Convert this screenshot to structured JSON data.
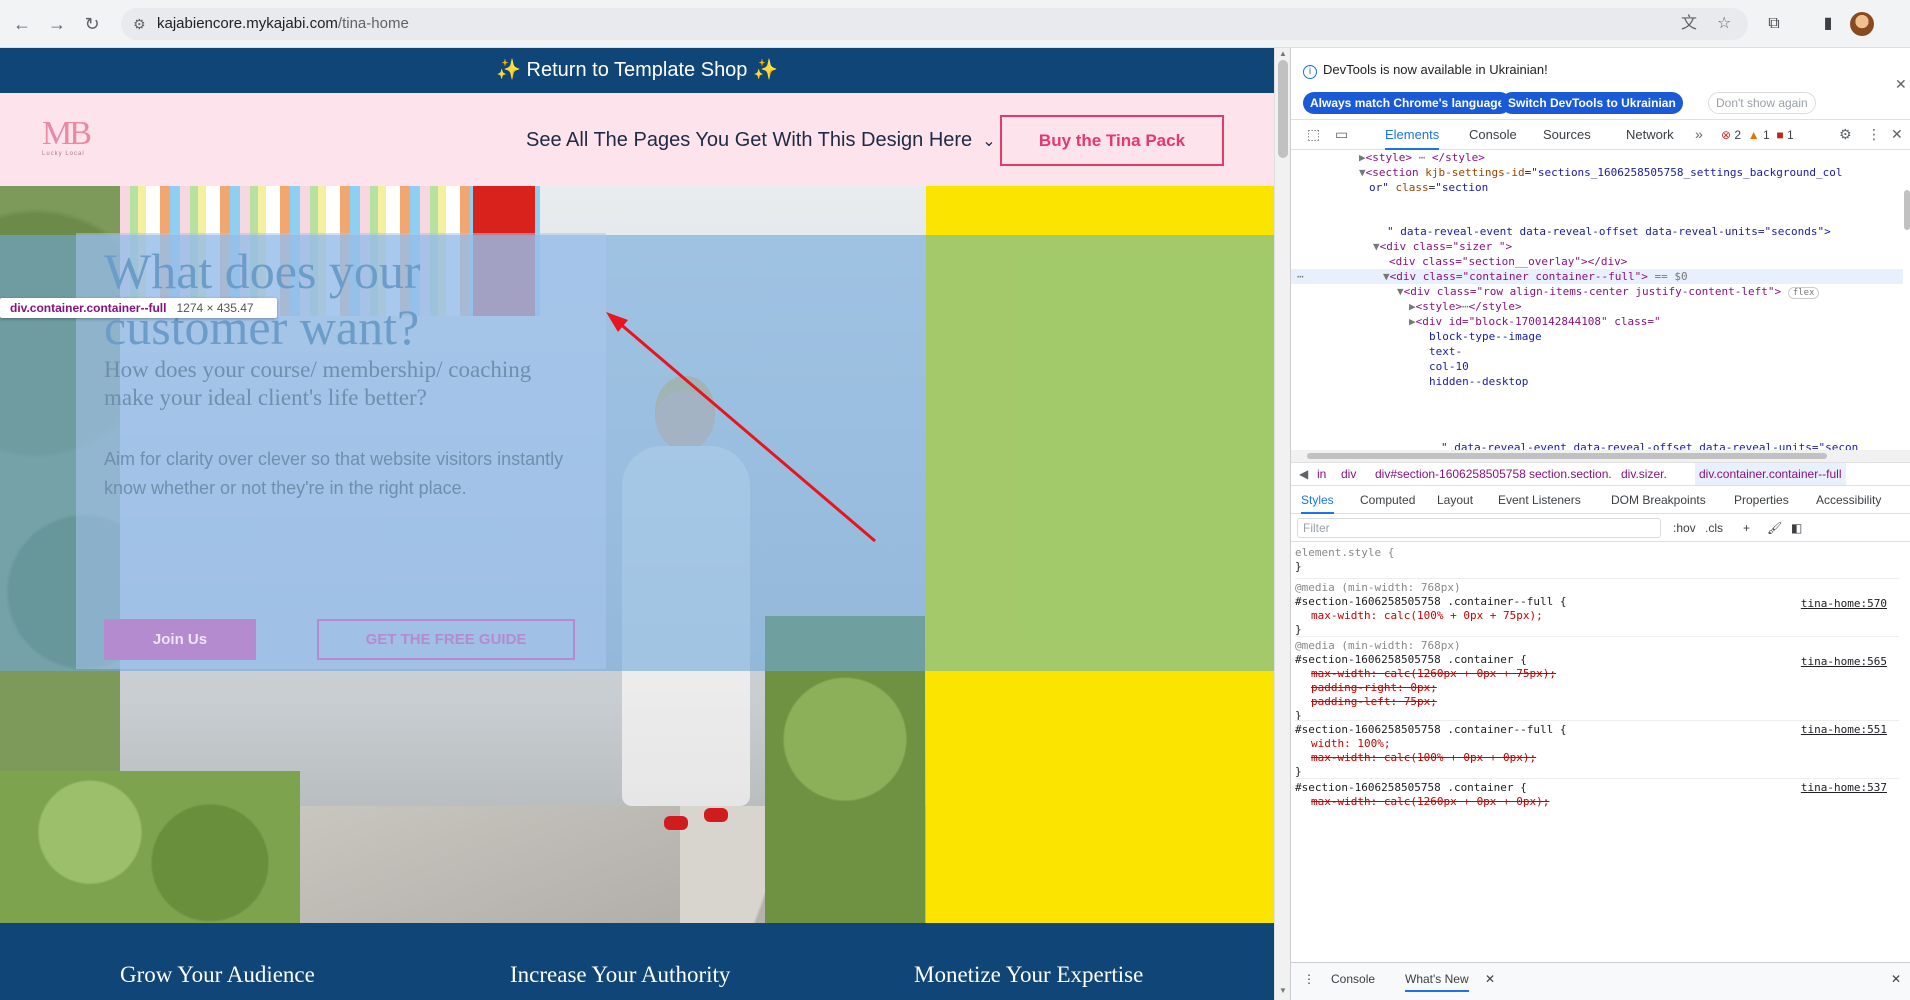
{
  "browser": {
    "url_host": "kajabiencore.mykajabi.com",
    "url_path": "/tina-home"
  },
  "page": {
    "topbar_text": "✨ Return to Template Shop ✨",
    "logo_text": "MB",
    "logo_sub": "Lucky Local",
    "nav_link": "See All The Pages You Get With This Design Here",
    "buy_button": "Buy the Tina Pack",
    "hero": {
      "title": "What does your customer want?",
      "subtitle": "How does your course/ membership/ coaching make your ideal client's life better?",
      "body": "Aim for clarity over clever so that website visitors instantly know whether or not they're in the right place.",
      "join_button": "Join Us",
      "guide_button": "GET THE FREE GUIDE"
    },
    "tooltip": {
      "selector": "div.container.container--full",
      "dims": "1274 × 435.47"
    },
    "features": [
      "Grow Your Audience",
      "Increase Your Authority",
      "Monetize Your Expertise"
    ]
  },
  "devtools": {
    "info_message": "DevTools is now available in Ukrainian!",
    "btn_match": "Always match Chrome's language",
    "btn_switch": "Switch DevTools to Ukrainian",
    "btn_dont": "Don't show again",
    "tabs": [
      "Elements",
      "Console",
      "Sources",
      "Network"
    ],
    "counts": {
      "errors": "2",
      "warnings": "1",
      "issues": "1"
    },
    "dom": {
      "l1": "<style>",
      "l1b": "</style>",
      "l2a": "<section",
      "l2attr": "kjb-settings-id",
      "l2val": "\"sections_1606258505758_settings_background_col",
      "l3": "or\"",
      "l3attr": "class",
      "l3val": "\"section",
      "l4": "\" data-reveal-event data-reveal-offset data-reveal-units=\"seconds\">",
      "l5": "<div class=\"sizer \">",
      "l6": "<div class=\"section__overlay\"></div>",
      "l7": "<div class=\"container container--full\">",
      "l7b": "== $0",
      "l8": "<div class=\"row align-items-center justify-content-left\">",
      "l8b": "flex",
      "l9": "<style>",
      "l9b": "</style>",
      "l10": "<div id=\"block-1700142844108\" class=\"",
      "l11": "block-type--image",
      "l12": "text-",
      "l13": "col-10",
      "l14": "hidden--desktop",
      "l15": "\" data-reveal-event data-reveal-offset data-reveal-units=\"secon"
    },
    "crumbs": [
      "in",
      "div",
      "div#section-1606258505758",
      "section.section.",
      "div.sizer.",
      "div.container.container--full"
    ],
    "subtabs": [
      "Styles",
      "Computed",
      "Layout",
      "Event Listeners",
      "DOM Breakpoints",
      "Properties",
      "Accessibility"
    ],
    "filter_placeholder": "Filter",
    "hov": ":hov",
    "cls": ".cls",
    "styles": {
      "el_style": "element.style {",
      "close": "}",
      "media1": "@media (min-width: 768px)",
      "sel1": "#section-1606258505758 .container--full {",
      "src1": "tina-home:570",
      "p1": "max-width: calc(100% + 0px + 75px);",
      "media2": "@media (min-width: 768px)",
      "sel2": "#section-1606258505758 .container {",
      "src2": "tina-home:565",
      "p2a": "max-width: calc(1260px + 0px + 75px);",
      "p2b": "padding-right: 0px;",
      "p2c": "padding-left: 75px;",
      "sel3": "#section-1606258505758 .container--full {",
      "src3": "tina-home:551",
      "p3a": "width: 100%;",
      "p3b": "max-width: calc(100% + 0px + 0px);",
      "sel4": "#section-1606258505758 .container {",
      "src4": "tina-home:537",
      "p4a": "max-width: calc(1260px + 0px + 0px);"
    },
    "drawer": [
      "Console",
      "What's New"
    ]
  }
}
